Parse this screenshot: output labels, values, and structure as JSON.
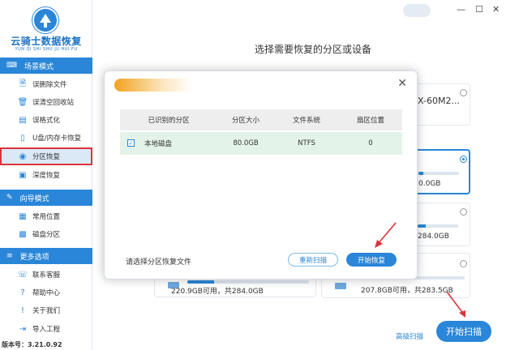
{
  "app": {
    "name": "云骑士数据恢复",
    "subtitle": "YUN QI SHI SHU JU HUI FU",
    "version": "版本号：3.21.0.92"
  },
  "sidebar": {
    "sections": [
      {
        "title": "场景模式",
        "items": [
          "误删除文件",
          "误清空回收站",
          "误格式化",
          "U盘/内存卡恢复",
          "分区恢复",
          "深度恢复"
        ]
      },
      {
        "title": "向导模式",
        "items": [
          "常用位置",
          "磁盘分区"
        ]
      },
      {
        "title": "更多选项",
        "items": [
          "联系客服",
          "帮助中心",
          "关于我们",
          "导入工程"
        ]
      }
    ],
    "active_item": "分区恢复"
  },
  "main": {
    "title": "选择需要恢复的分区或设备",
    "cards": [
      {
        "text": "X-60M2..."
      },
      {
        "text": "0.0GB"
      },
      {
        "text": "284.0GB"
      },
      {
        "text": "0.0GB"
      },
      {
        "text": "220.9GB可用，共284.0GB"
      },
      {
        "text": "207.8GB可用，共283.5GB"
      }
    ],
    "scan_button": "开始扫描",
    "advanced_link": "高级扫描",
    "window_controls": {
      "minimize": "—",
      "maximize": "☐",
      "close": "✕"
    }
  },
  "dialog": {
    "close": "✕",
    "columns": [
      "已识别的分区",
      "分区大小",
      "文件系统",
      "扇区位置"
    ],
    "rows": [
      {
        "checked": "✓",
        "name": "本地磁盘",
        "size": "80.0GB",
        "fs": "NTFS",
        "sector": "0"
      }
    ],
    "hint": "请选择分区恢复文件",
    "rescan_button": "重新扫描",
    "start_button": "开始恢复"
  },
  "colors": {
    "accent": "#2a86d8",
    "highlight": "#d9343b",
    "row": "#e4f3e9"
  }
}
